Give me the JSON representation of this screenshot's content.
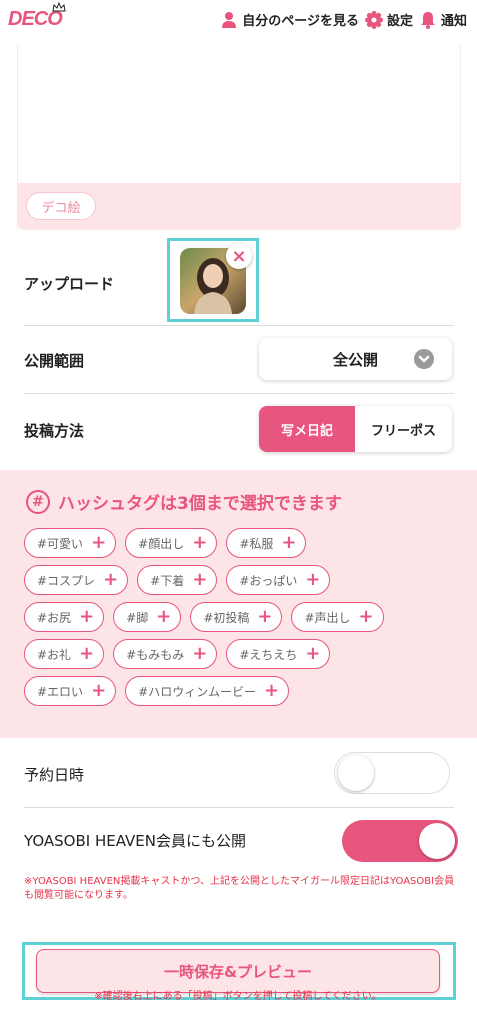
{
  "header": {
    "logo": "DECO",
    "my_page": "自分のページを見る",
    "settings": "設定",
    "notifications": "通知"
  },
  "editor": {
    "deco_button": "デコ絵"
  },
  "upload": {
    "label": "アップロード"
  },
  "visibility": {
    "label": "公開範囲",
    "selected": "全公開"
  },
  "post_method": {
    "label": "投稿方法",
    "options": [
      "写メ日記",
      "フリーポス"
    ],
    "active": "写メ日記"
  },
  "hashtags": {
    "badge": "#",
    "title": "ハッシュタグは3個まで選択できます",
    "rows": [
      [
        "#可愛い",
        "#顔出し",
        "#私服"
      ],
      [
        "#コスプレ",
        "#下着",
        "#おっぱい"
      ],
      [
        "#お尻",
        "#脚",
        "#初投稿",
        "#声出し"
      ],
      [
        "#お礼",
        "#もみもみ",
        "#えちえち"
      ],
      [
        "#エロい",
        "#ハロウィンムービー"
      ]
    ]
  },
  "schedule": {
    "label": "予約日時",
    "enabled": false
  },
  "yoasobi": {
    "label": "YOASOBI HEAVEN会員にも公開",
    "enabled": true,
    "note": "※YOASOBI HEAVEN掲載キャストかつ、上記を公開としたマイガール限定日記はYOASOBI会員も閲覧可能になります。"
  },
  "actions": {
    "preview": "一時保存&プレビュー",
    "bottom_note": "※確認後右上にある「投稿」ボタンを押して投稿してください。"
  },
  "colors": {
    "accent": "#e8557e",
    "panel": "#fde4e7",
    "highlight": "#5fd0d6"
  }
}
